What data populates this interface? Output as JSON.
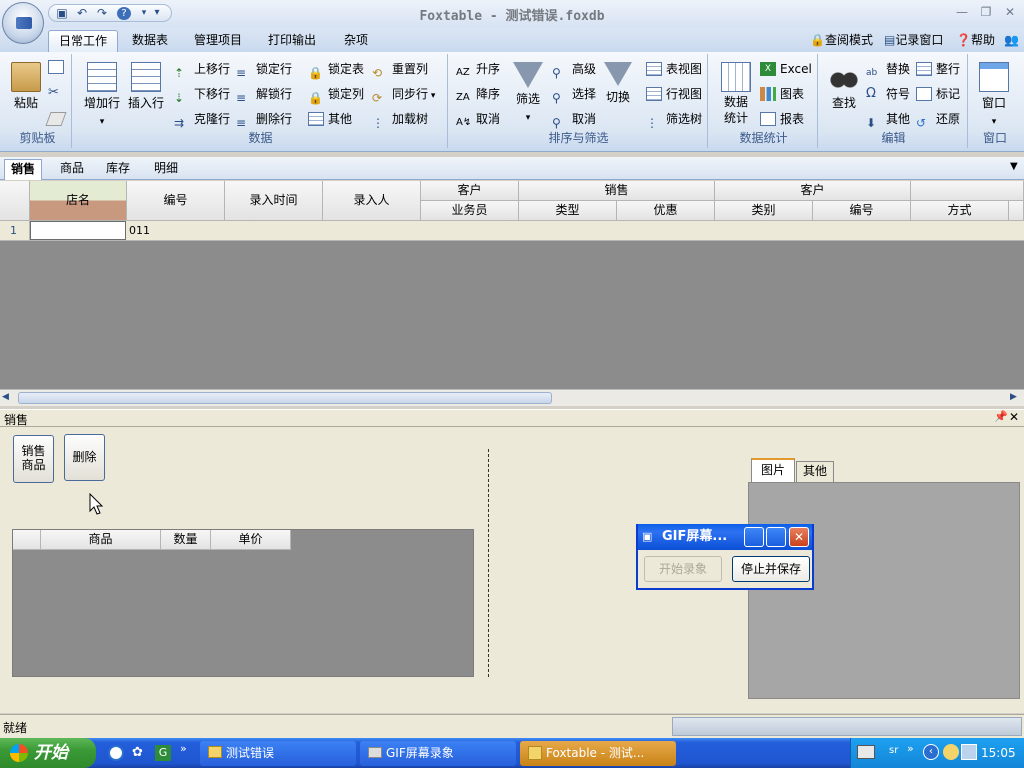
{
  "title": "Foxtable - 测试错误.foxdb",
  "ribbon_tabs": [
    "日常工作",
    "数据表",
    "管理项目",
    "打印输出",
    "杂项"
  ],
  "ribbon_links": [
    "查阅模式",
    "记录窗口",
    "帮助"
  ],
  "groups": {
    "clipboard": {
      "name": "剪贴板",
      "paste": "粘贴"
    },
    "data": {
      "name": "数据",
      "add_row": "增加行",
      "insert_row": "插入行",
      "small": [
        "上移行",
        "锁定行",
        "锁定表",
        "重置列",
        "下移行",
        "解锁行",
        "锁定列",
        "同步行",
        "克隆行",
        "删除行",
        "其他",
        "加载树"
      ]
    },
    "sort": {
      "name": "排序与筛选",
      "small1": [
        "升序",
        "降序",
        "取消"
      ],
      "filter": "筛选",
      "small2": [
        "高级",
        "选择",
        "取消"
      ],
      "switch": "切换",
      "small3": [
        "表视图",
        "行视图",
        "筛选树"
      ]
    },
    "stats": {
      "name": "数据统计",
      "stats_btn": "数据统计",
      "small": [
        "Excel",
        "图表",
        "报表"
      ]
    },
    "edit": {
      "name": "编辑",
      "find": "查找",
      "small": [
        "替换",
        "整行",
        "符号",
        "标记",
        "其他",
        "还原"
      ]
    },
    "window": {
      "name": "窗口",
      "btn": "窗口"
    }
  },
  "sheet_tabs": [
    "销售",
    "商品",
    "库存",
    "明细"
  ],
  "grid": {
    "group_headers": [
      "客户",
      "销售",
      "客户"
    ],
    "col_headers": [
      "店名",
      "编号",
      "录入时间",
      "录入人",
      "业务员",
      "类型",
      "优惠",
      "类别",
      "编号",
      "方式"
    ],
    "rows": [
      {
        "num": "1",
        "cells": [
          "",
          "011"
        ]
      }
    ]
  },
  "panel": {
    "title": "销售",
    "btn_sales_product": "销售商品",
    "btn_delete": "删除",
    "subgrid_headers": [
      "商品",
      "数量",
      "单价"
    ],
    "tabs": [
      "图片",
      "其他"
    ]
  },
  "status": "就绪",
  "gif_window": {
    "title": "GIF屏幕...",
    "start": "开始录象",
    "stop": "停止并保存"
  },
  "taskbar": {
    "start": "开始",
    "items": [
      "测试错误",
      "GIF屏幕录象",
      "Foxtable - 测试..."
    ],
    "tray_text": "sr",
    "clock": "15:05"
  }
}
